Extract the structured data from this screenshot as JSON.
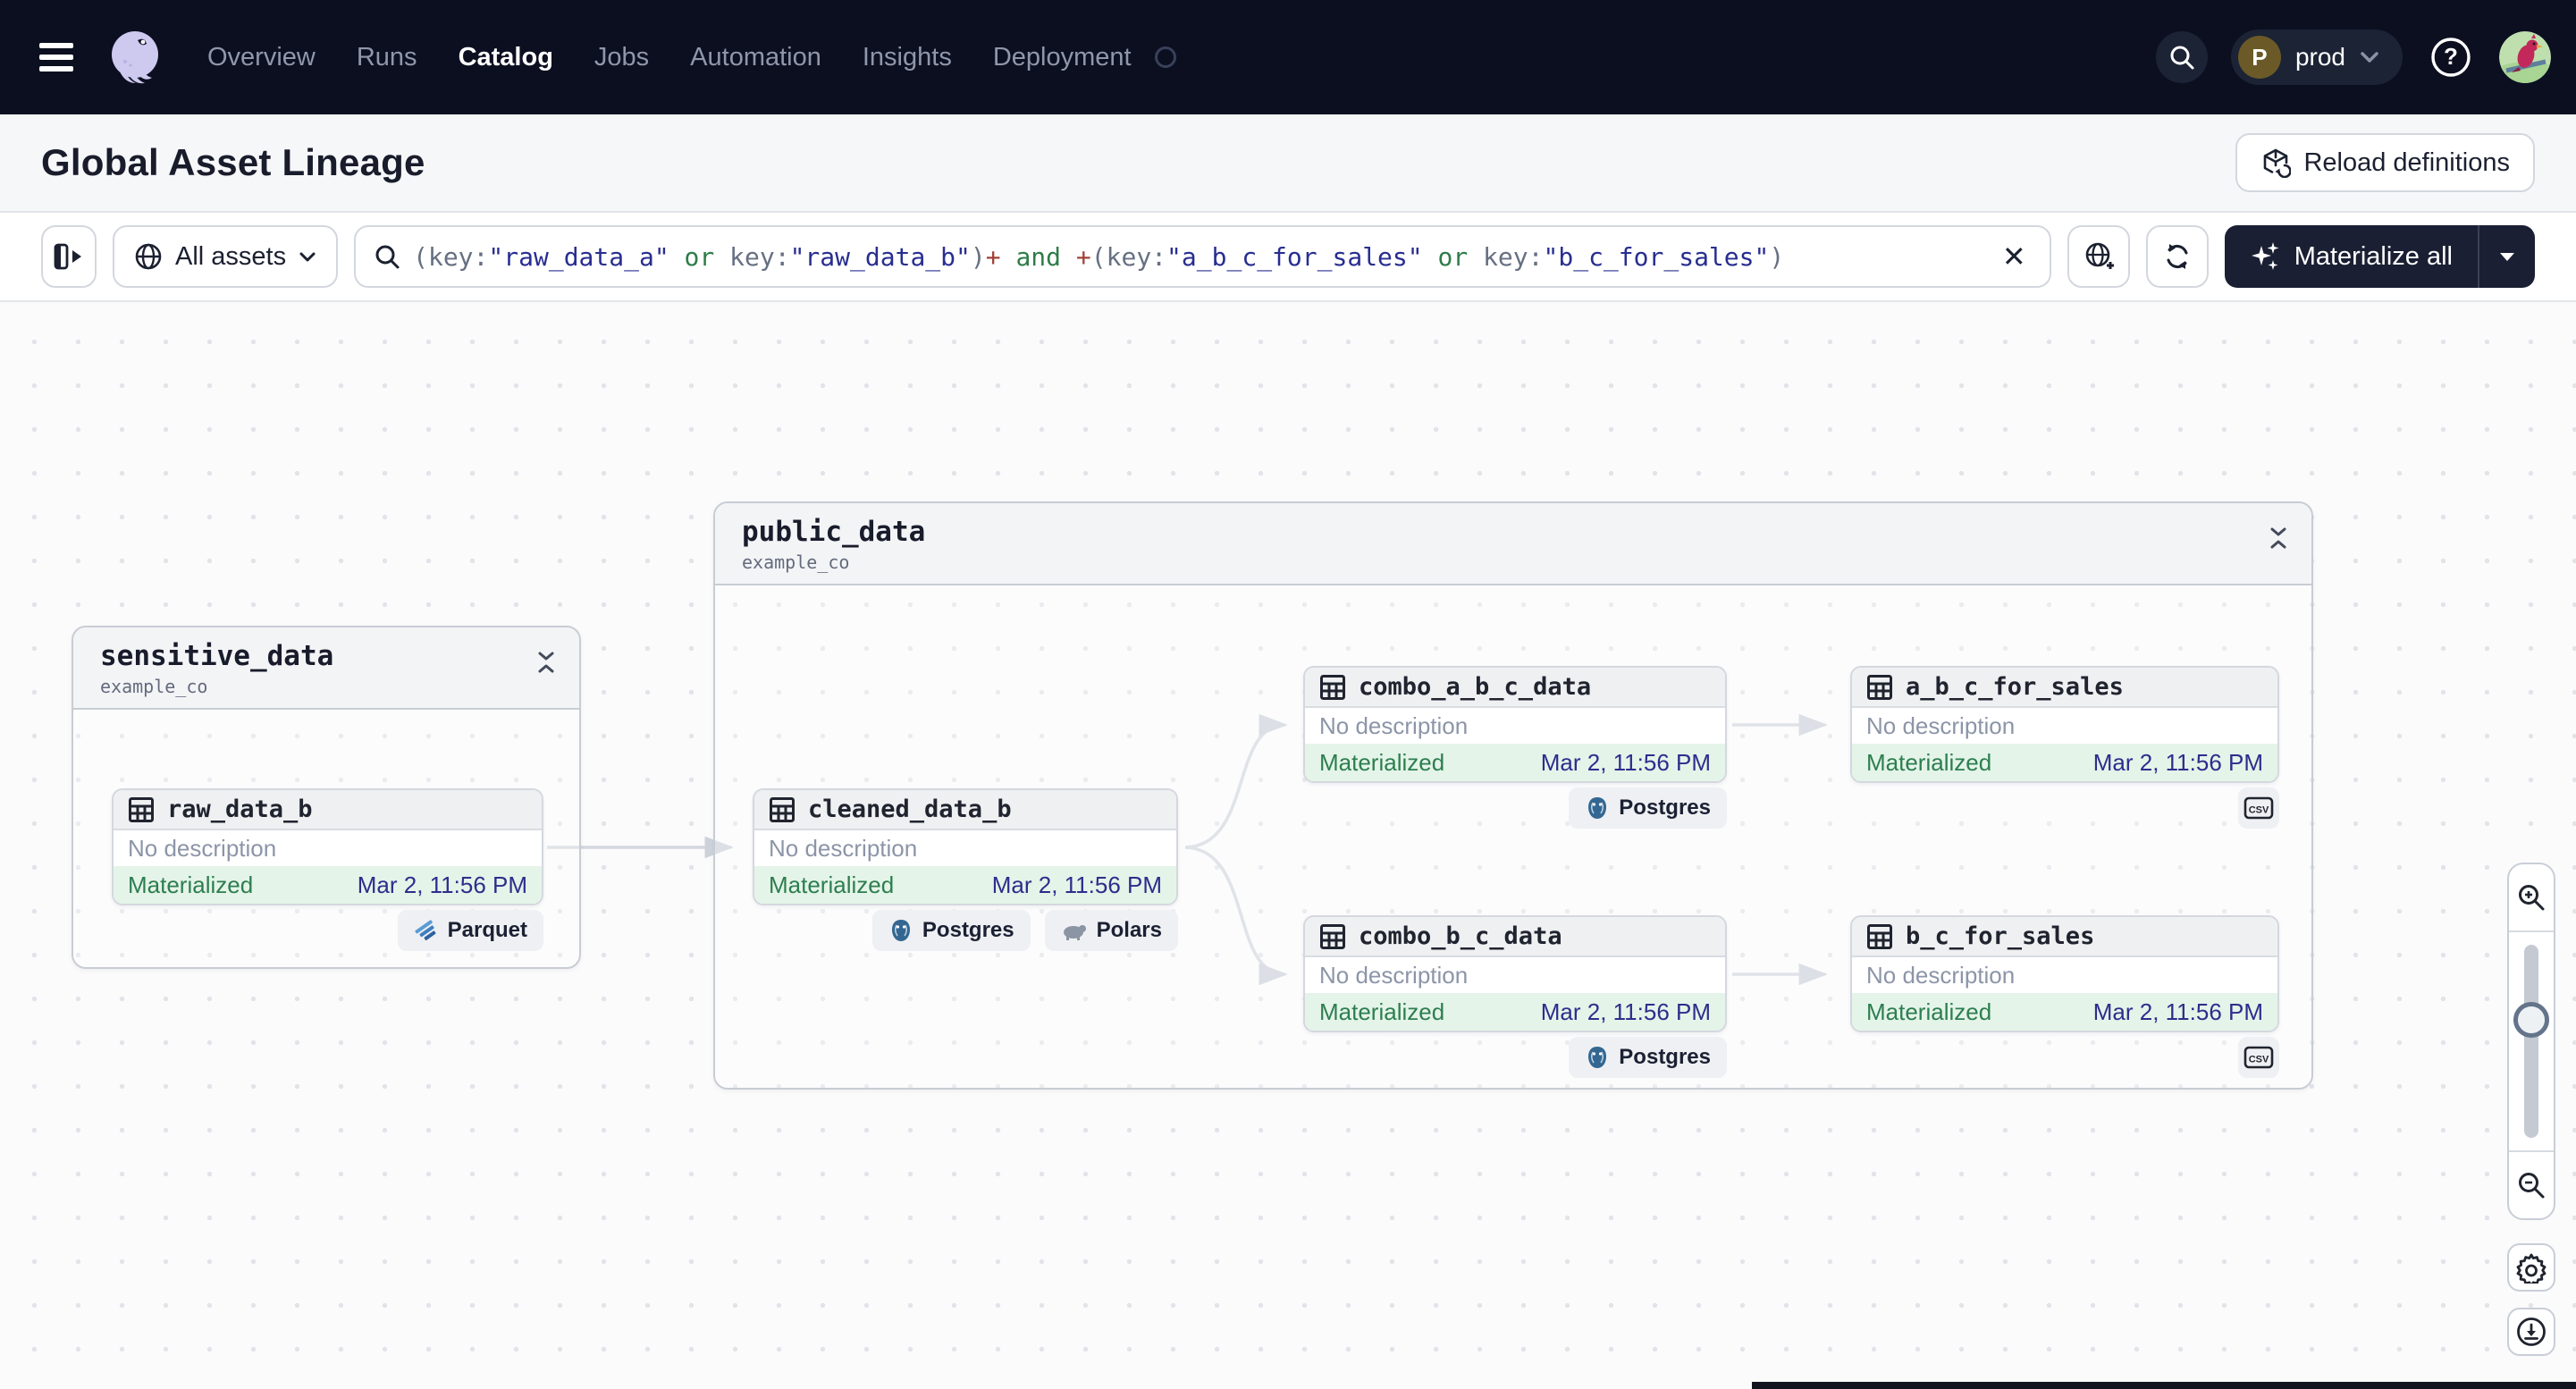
{
  "navbar": {
    "items": [
      "Overview",
      "Runs",
      "Catalog",
      "Jobs",
      "Automation",
      "Insights",
      "Deployment"
    ],
    "active_item": "Catalog",
    "environment": {
      "initial": "P",
      "label": "prod"
    }
  },
  "header": {
    "title": "Global Asset Lineage",
    "reload_button": "Reload definitions"
  },
  "filter_bar": {
    "asset_scope": "All assets",
    "clear_label": "✕",
    "materialize_button": "Materialize all",
    "query_segments": [
      {
        "type": "key",
        "text": "(key:"
      },
      {
        "type": "str",
        "text": "\"raw_data_a\""
      },
      {
        "type": "op",
        "text": " or "
      },
      {
        "type": "key",
        "text": "key:"
      },
      {
        "type": "str",
        "text": "\"raw_data_b\""
      },
      {
        "type": "key",
        "text": ")"
      },
      {
        "type": "plus",
        "text": "+"
      },
      {
        "type": "op",
        "text": " and "
      },
      {
        "type": "plus",
        "text": "+"
      },
      {
        "type": "key",
        "text": "(key:"
      },
      {
        "type": "str",
        "text": "\"a_b_c_for_sales\""
      },
      {
        "type": "op",
        "text": " or "
      },
      {
        "type": "key",
        "text": "key:"
      },
      {
        "type": "str",
        "text": "\"b_c_for_sales\""
      },
      {
        "type": "key",
        "text": ")"
      }
    ]
  },
  "graph": {
    "groups": [
      {
        "name": "sensitive_data",
        "subtitle": "example_co"
      },
      {
        "name": "public_data",
        "subtitle": "example_co"
      }
    ],
    "nodes": [
      {
        "name": "raw_data_b",
        "description": "No description",
        "status": "Materialized",
        "timestamp": "Mar 2, 11:56 PM",
        "badges": [
          "Parquet"
        ]
      },
      {
        "name": "cleaned_data_b",
        "description": "No description",
        "status": "Materialized",
        "timestamp": "Mar 2, 11:56 PM",
        "badges": [
          "Postgres",
          "Polars"
        ]
      },
      {
        "name": "combo_a_b_c_data",
        "description": "No description",
        "status": "Materialized",
        "timestamp": "Mar 2, 11:56 PM",
        "badges": [
          "Postgres"
        ]
      },
      {
        "name": "a_b_c_for_sales",
        "description": "No description",
        "status": "Materialized",
        "timestamp": "Mar 2, 11:56 PM",
        "badges": [
          "csv"
        ]
      },
      {
        "name": "combo_b_c_data",
        "description": "No description",
        "status": "Materialized",
        "timestamp": "Mar 2, 11:56 PM",
        "badges": [
          "Postgres"
        ]
      },
      {
        "name": "b_c_for_sales",
        "description": "No description",
        "status": "Materialized",
        "timestamp": "Mar 2, 11:56 PM",
        "badges": [
          "csv"
        ]
      }
    ],
    "badge_labels": {
      "parquet": "Parquet",
      "postgres": "Postgres",
      "polars": "Polars",
      "csv": "CSV"
    }
  },
  "colors": {
    "navbar_bg": "#0B0F20",
    "materialized_text": "#2D7E4F",
    "materialized_bg": "#E4F4E9",
    "timestamp_text": "#2E2D8C",
    "materialize_button_bg": "#1A1F33",
    "edge": "#D3D7DE"
  }
}
